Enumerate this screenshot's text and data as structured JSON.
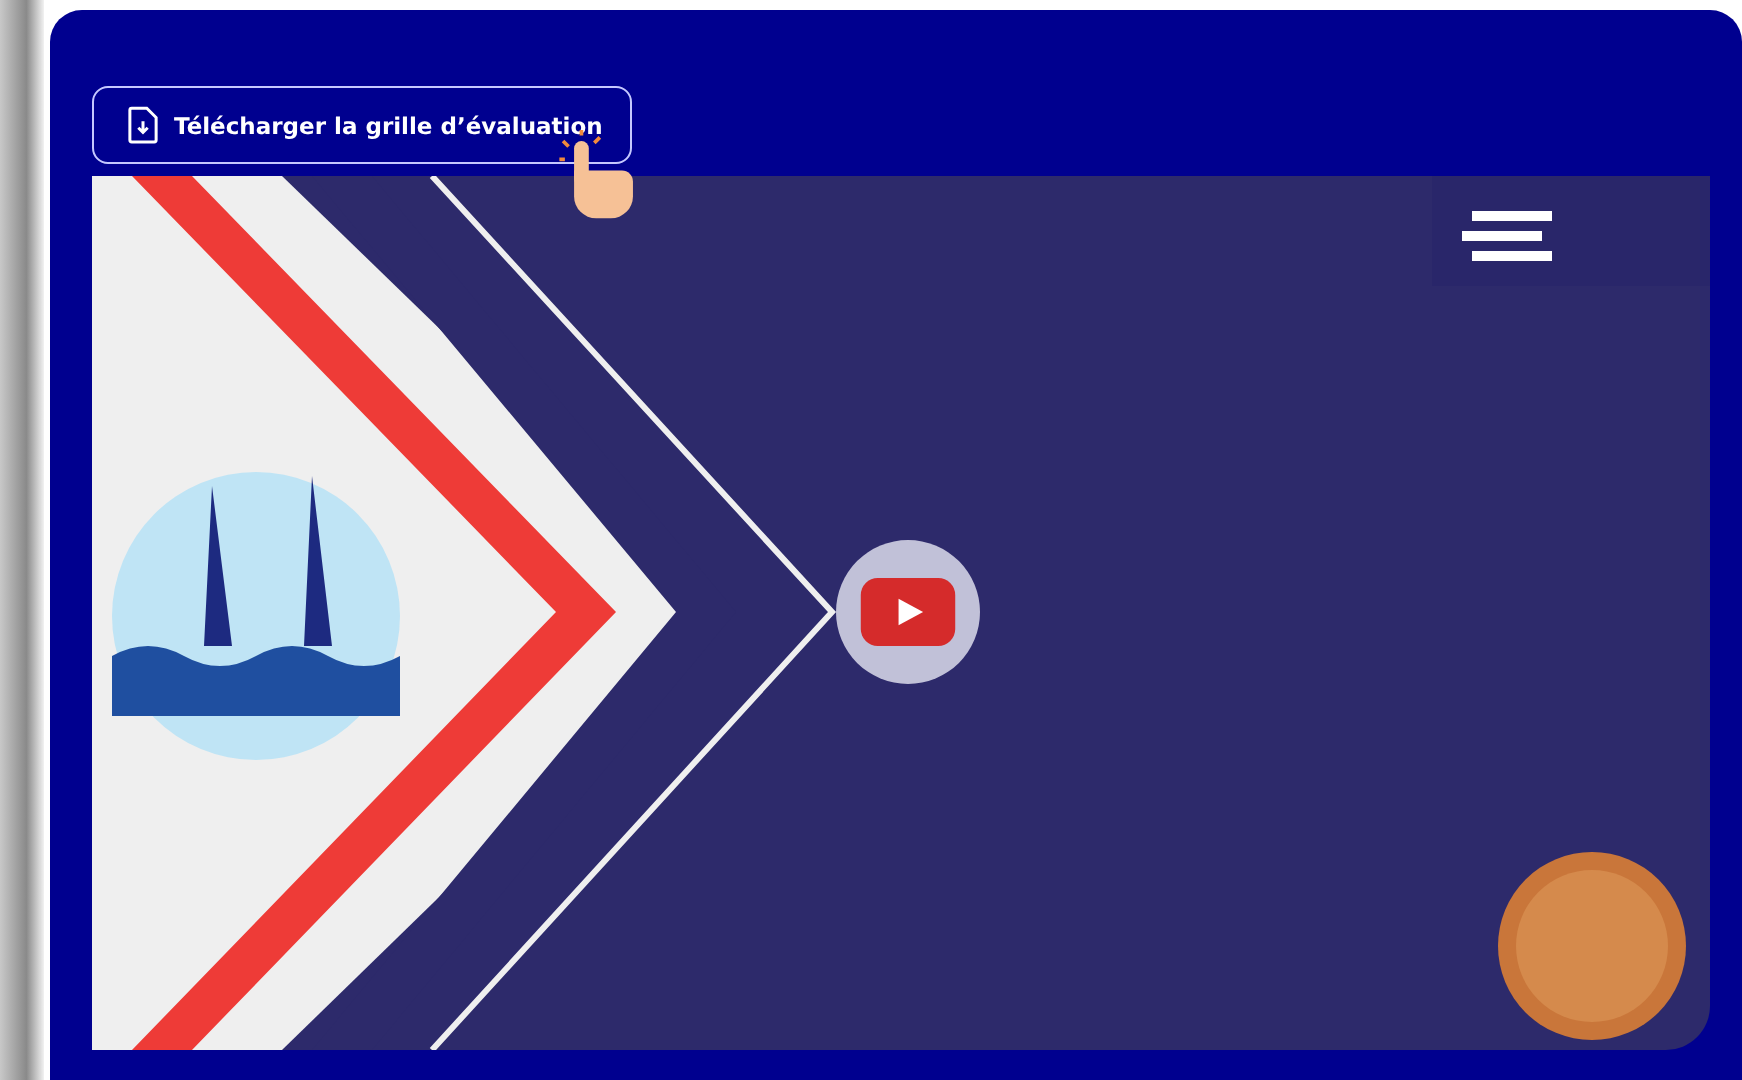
{
  "download_button": {
    "label": "Télécharger la grille d’évaluation"
  },
  "video": {
    "kind": "youtube"
  }
}
